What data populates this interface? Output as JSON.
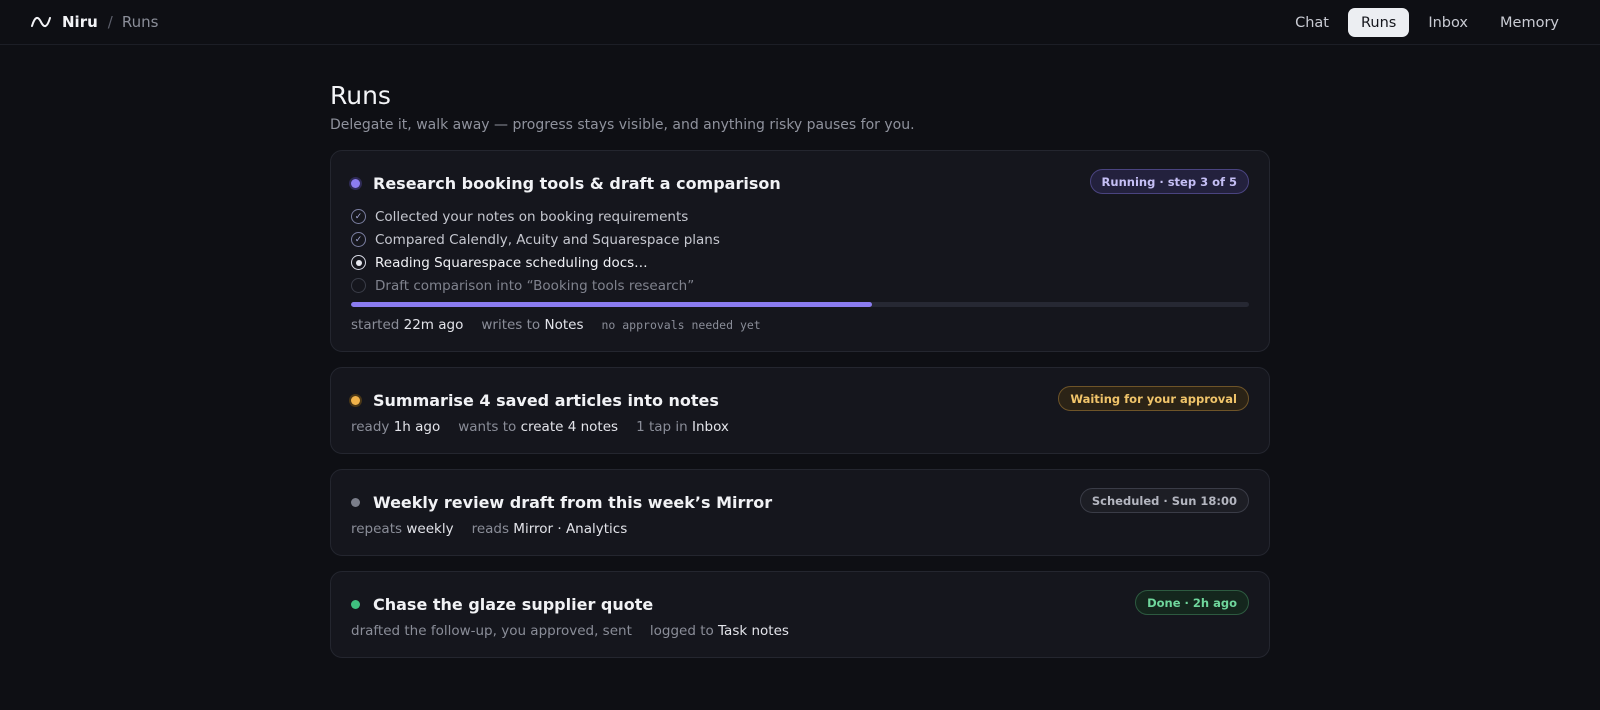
{
  "header": {
    "brand": "Niru",
    "separator": "/",
    "crumb": "Runs",
    "nav": [
      "Chat",
      "Runs",
      "Inbox",
      "Memory"
    ]
  },
  "page": {
    "title": "Runs",
    "subtitle": "Delegate it, walk away — progress stays visible, and anything risky pauses for you."
  },
  "runs": [
    {
      "title": "Research booking tools & draft a comparison",
      "status": "Running · step 3 of 5",
      "steps": [
        "Collected your notes on booking requirements",
        "Compared Calendly, Acuity and Squarespace plans",
        "Reading Squarespace scheduling docs…",
        "Draft comparison into “Booking tools research”"
      ],
      "progress": 0.58,
      "meta": {
        "started_label": "started",
        "started_value": "22m ago",
        "writes_label": "writes to",
        "writes_value": "Notes",
        "approvals": "no approvals needed yet"
      }
    },
    {
      "title": "Summarise 4 saved articles into notes",
      "status": "Waiting for your approval",
      "meta": {
        "ready_label": "ready",
        "ready_value": "1h ago",
        "wants_label": "wants to",
        "wants_value": "create 4 notes",
        "tap_label": "1 tap in",
        "tap_value": "Inbox"
      }
    },
    {
      "title": "Weekly review draft from this week’s Mirror",
      "status": "Scheduled · Sun 18:00",
      "meta": {
        "repeats_label": "repeats",
        "repeats_value": "weekly",
        "reads_label": "reads",
        "reads_value": "Mirror · Analytics"
      }
    },
    {
      "title": "Chase the glaze supplier quote",
      "status": "Done · 2h ago",
      "meta": {
        "drafted": "drafted the follow-up, you approved, sent",
        "logged_label": "logged to",
        "logged_value": "Task notes"
      }
    }
  ],
  "colors": {
    "running": "#8b7cf0",
    "waiting": "#f0b24a",
    "scheduled": "#7b7e8a",
    "done": "#3fbf7f"
  }
}
